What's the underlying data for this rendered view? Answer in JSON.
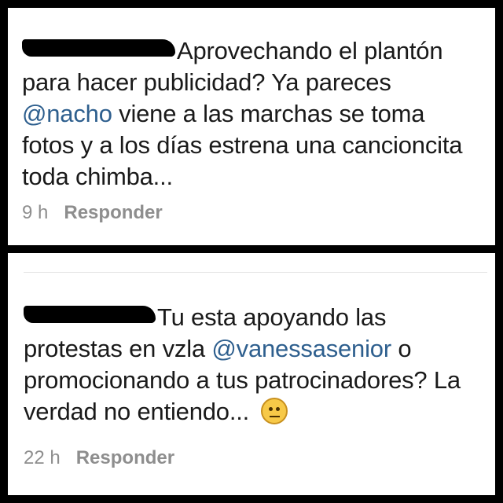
{
  "comments": [
    {
      "username": "",
      "text_before": "Aprovechando el plantón para hacer publicidad? Ya pareces ",
      "mention": "@nacho",
      "text_after": " viene a las marchas se toma fotos y a los días estrena una cancioncita  toda chimba...",
      "time": "9 h",
      "reply_label": "Responder"
    },
    {
      "username": "",
      "text_before": "Tu esta apoyando las protestas en vzla ",
      "mention": "@vanessasenior",
      "text_after": " o promocionando a tus patrocinadores? La verdad no entiendo... ",
      "emoji": "neutral-face-emoji",
      "time": "22 h",
      "reply_label": "Responder"
    }
  ]
}
